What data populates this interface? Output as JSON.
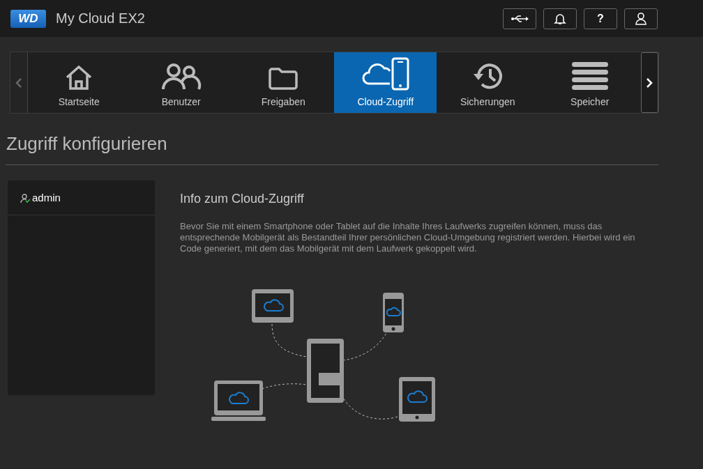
{
  "header": {
    "logo": "WD",
    "product": "My Cloud",
    "model": "EX2",
    "actions": [
      {
        "kind": "usb"
      },
      {
        "kind": "bell"
      },
      {
        "kind": "help",
        "label": "?"
      },
      {
        "kind": "user"
      }
    ]
  },
  "nav": {
    "tabs": [
      {
        "label": "Startseite",
        "kind": "home",
        "selected": false
      },
      {
        "label": "Benutzer",
        "kind": "users",
        "selected": false
      },
      {
        "label": "Freigaben",
        "kind": "folder",
        "selected": false
      },
      {
        "label": "Cloud-Zugriff",
        "kind": "cloud",
        "selected": true
      },
      {
        "label": "Sicherungen",
        "kind": "history",
        "selected": false
      },
      {
        "label": "Speicher",
        "kind": "storage",
        "selected": false
      }
    ]
  },
  "page_title": "Zugriff konfigurieren",
  "users": [
    {
      "name": "admin"
    }
  ],
  "info": {
    "heading": "Info zum Cloud-Zugriff",
    "text": "Bevor Sie mit einem Smartphone oder Tablet auf die Inhalte Ihres Laufwerks zugreifen können, muss das entsprechende Mobilgerät als Bestandteil Ihrer persönlichen Cloud-Umgebung registriert werden. Hierbei wird ein Code generiert, mit dem das Mobilgerät mit dem Laufwerk gekoppelt wird."
  }
}
